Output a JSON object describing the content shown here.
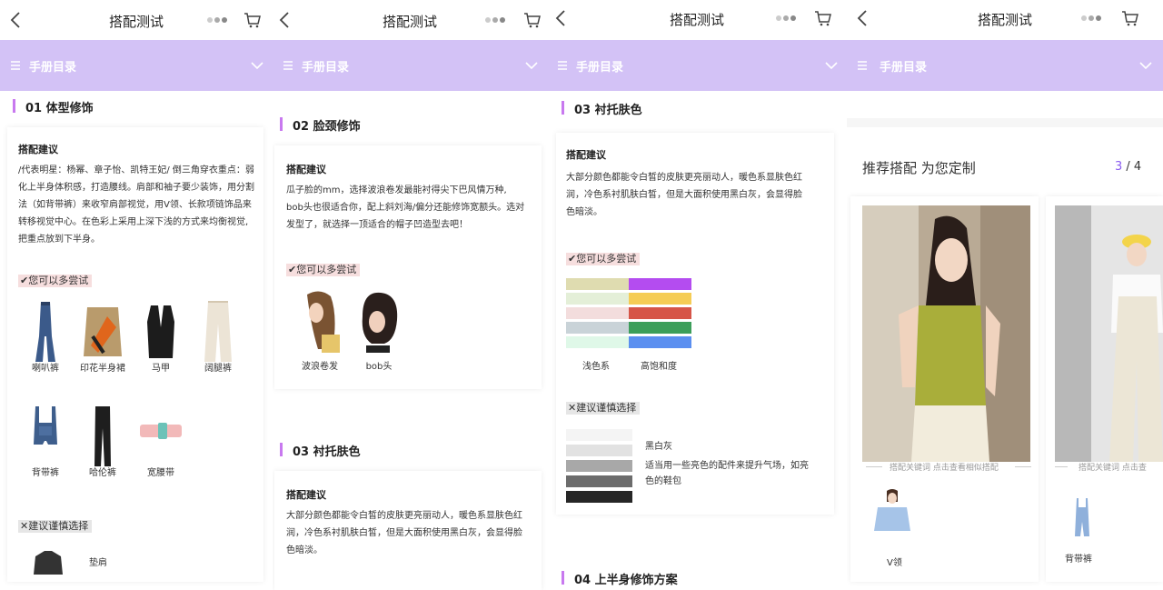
{
  "header": {
    "title": "搭配测试"
  },
  "toc_bar": {
    "label": "手册目录"
  },
  "panel1": {
    "section_title": "01 体型修饰",
    "advice_title": "搭配建议",
    "advice_lines": [
      "/代表明星：杨幂、章子怡、凯特王妃/ 倒三角穿衣重点：弱",
      "化上半身体积感，打造腰线。肩部和袖子要少装饰，用分割",
      "法（如背带裤）来收窄肩部视觉，用V领、长款项链饰品来",
      "转移视觉中心。在色彩上采用上深下浅的方式来均衡视觉,",
      "把重点放到下半身。"
    ],
    "try_tag": "✔您可以多尝试",
    "try_items": [
      "喇叭裤",
      "印花半身裙",
      "马甲",
      "阔腿裤",
      "背带裤",
      "哈伦裤",
      "宽腰带"
    ],
    "avoid_tag": "✕建议谨慎选择",
    "avoid_items": [
      "垫肩"
    ]
  },
  "panel2": {
    "section_title": "02 脸颈修饰",
    "advice_title": "搭配建议",
    "advice_lines": [
      "瓜子脸的mm，选择波浪卷发最能衬得尖下巴风情万种,",
      "bob头也很适合你，配上斜刘海/偏分还能修饰宽额头。选对",
      "发型了，就选择一顶适合的帽子凹造型去吧！"
    ],
    "try_tag": "✔您可以多尝试",
    "try_items": [
      "波浪卷发",
      "bob头"
    ],
    "section2_title": "03 衬托肤色",
    "advice2_title": "搭配建议",
    "advice2_lines": [
      "大部分颜色都能令白皙的皮肤更亮丽动人，暖色系显肤色红",
      "润，冷色系衬肌肤白皙，但是大面积使用黑白灰，会显得脸",
      "色暗淡。"
    ]
  },
  "panel3": {
    "section_title": "03 衬托肤色",
    "advice_title": "搭配建议",
    "advice_lines": [
      "大部分颜色都能令白皙的皮肤更亮丽动人，暖色系显肤色红",
      "润，冷色系衬肌肤白皙，但是大面积使用黑白灰，会显得脸",
      "色暗淡。"
    ],
    "try_tag": "✔您可以多尝试",
    "light_label": "浅色系",
    "sat_label": "高饱和度",
    "light_colors": [
      "#dfdcb0",
      "#e4efd8",
      "#f3dddd",
      "#c9d3d8",
      "#dff8e8"
    ],
    "sat_colors": [
      "#b44cf0",
      "#f5cc55",
      "#d65548",
      "#3c9e5a",
      "#5b8ff0"
    ],
    "avoid_tag": "✕建议谨慎选择",
    "gray_colors": [
      "#f4f4f4",
      "#e2e2e2",
      "#a8a8a8",
      "#6c6c6c",
      "#262626"
    ],
    "bw_label": "黑白灰",
    "bw_desc_lines": [
      "适当用一些亮色的配件来提升气场，如亮",
      "色的鞋包"
    ],
    "section2_title": "04 上半身修饰方案"
  },
  "panel4": {
    "title": "推荐搭配 为您定制",
    "page_current": "3",
    "page_total": " / 4",
    "hint": "搭配关键词 点击查看相似搭配",
    "hint2": "搭配关键词 点击查",
    "kw1": "V领",
    "kw2": "背带裤"
  },
  "colors": {
    "accent": "#c879ef",
    "bar": "#d3c2f6"
  }
}
